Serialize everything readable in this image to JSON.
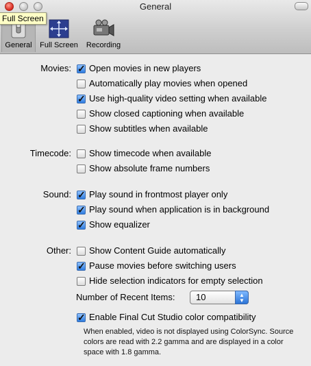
{
  "window": {
    "title": "General"
  },
  "toolbar": {
    "tooltip": "Full Screen",
    "items": [
      {
        "label": "General",
        "icon": "switch-icon",
        "selected": true
      },
      {
        "label": "Full Screen",
        "icon": "fullscreen-arrows-icon",
        "selected": false
      },
      {
        "label": "Recording",
        "icon": "video-camera-icon",
        "selected": false
      }
    ]
  },
  "sections": {
    "movies": {
      "label": "Movies:",
      "options": [
        {
          "label": "Open movies in new players",
          "checked": true
        },
        {
          "label": "Automatically play movies when opened",
          "checked": false
        },
        {
          "label": "Use high-quality video setting when available",
          "checked": true
        },
        {
          "label": "Show closed captioning when available",
          "checked": false
        },
        {
          "label": "Show subtitles when available",
          "checked": false
        }
      ]
    },
    "timecode": {
      "label": "Timecode:",
      "options": [
        {
          "label": "Show timecode when available",
          "checked": false
        },
        {
          "label": "Show absolute frame numbers",
          "checked": false
        }
      ]
    },
    "sound": {
      "label": "Sound:",
      "options": [
        {
          "label": "Play sound in frontmost player only",
          "checked": true
        },
        {
          "label": "Play sound when application is in background",
          "checked": true
        },
        {
          "label": "Show equalizer",
          "checked": true
        }
      ]
    },
    "other": {
      "label": "Other:",
      "options": [
        {
          "label": "Show Content Guide automatically",
          "checked": false
        },
        {
          "label": "Pause movies before switching users",
          "checked": true
        },
        {
          "label": "Hide selection indicators for empty selection",
          "checked": false
        }
      ],
      "recent_items": {
        "label": "Number of Recent Items:",
        "value": "10"
      },
      "colorsync": {
        "label": "Enable Final Cut Studio color compatibility",
        "checked": true,
        "note": "When enabled, video is not displayed using ColorSync. Source colors are read with 2.2 gamma and are displayed in a color space with 1.8 gamma."
      }
    }
  },
  "colors": {
    "accent": "#2f7de0",
    "background": "#ececec"
  }
}
